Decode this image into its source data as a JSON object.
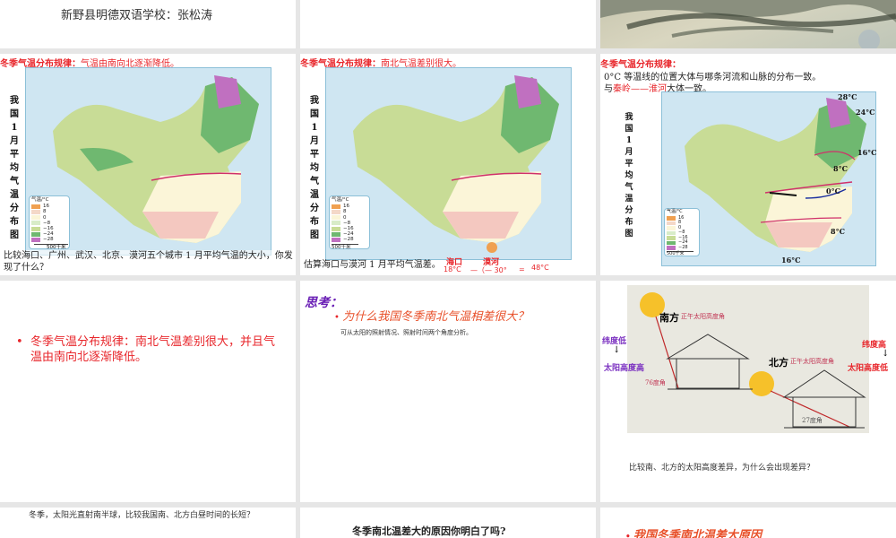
{
  "slides": [
    {
      "author": "新野县明德双语学校：张松涛"
    },
    {},
    {
      "image": "landscape-painting"
    },
    {
      "heading_label": "冬季气温分布规律：",
      "heading_text": "气温由南向北逐渐降低。",
      "map_title": "我国1月平均气温分布图",
      "question": "比较海口、广州、武汉、北京、漠河五个城市 1 月平均气温的大小，你发现了什么？"
    },
    {
      "heading_label": "冬季气温分布规律：",
      "heading_text": "南北气温差别很大。",
      "map_title": "我国1月平均气温分布图",
      "question": "估算海口与漠河 1 月平均气温差。",
      "haikou": "海口",
      "mohe": "漠河",
      "haikou_temp": "18°C",
      "minus": "—（— 30°",
      "equals": "=",
      "diff": "48°C"
    },
    {
      "heading_label": "冬季气温分布规律：",
      "line1": "0°C 等温线的位置大体与哪条河流和山脉的分布一致。",
      "line2_prefix": "与",
      "line2_red": "秦岭——淮河",
      "line2_suffix": "大体一致。",
      "map_title": "我国1月平均气温分布图",
      "labels": [
        "28°C",
        "24°C",
        "16°C",
        "8°C",
        "0°C",
        "8°C",
        "16°C"
      ]
    },
    {
      "bullet": "冬季气温分布规律：南北气温差别很大，并且气温由南向北逐渐降低。"
    },
    {
      "title": "思考：",
      "question": "为什么我国冬季南北气温相差很大？",
      "hint": "可从太阳的照射情况、照射时间两个角度分析。"
    },
    {
      "south": "南方",
      "north": "北方",
      "noon_angle": "正午太阳高度角",
      "angle_south": "76度角",
      "angle_north": "27度角",
      "left_top": "纬度低",
      "left_bottom": "太阳高度高",
      "right_top": "纬度高",
      "right_bottom": "太阳高度低",
      "question": "比较南、北方的太阳高度差异，为什么会出现差异？"
    },
    {
      "text": "冬季，太阳光直射南半球，比较我国南、北方白昼时间的长短？"
    },
    {
      "text": "冬季南北温差大的原因你明白了吗?"
    },
    {
      "bullet": "我国冬季南北温差大原因"
    }
  ],
  "legend": {
    "title": "气温/°C",
    "values": [
      "16",
      "8",
      "0",
      "−8",
      "−16",
      "−24",
      "−28"
    ],
    "scale": "500千米"
  }
}
